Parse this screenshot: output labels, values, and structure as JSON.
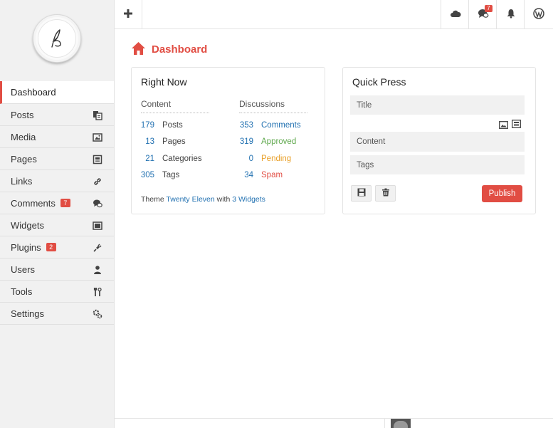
{
  "app": {
    "title": "Dashboard"
  },
  "colors": {
    "accent": "#e14d43",
    "link": "#2271b1",
    "approved": "#5fa84d",
    "pending": "#e9a12b",
    "spam": "#e14d43"
  },
  "topbar": {
    "add_icon": "plus-icon",
    "cloud_icon": "cloud-icon",
    "comments_icon": "comment-bubble-icon",
    "comments_badge": "7",
    "bell_icon": "bell-icon",
    "wp_icon": "wordpress-icon"
  },
  "sidebar": {
    "logo_icon": "pen-logo-icon",
    "items": [
      {
        "label": "Dashboard",
        "icon": "",
        "badge": ""
      },
      {
        "label": "Posts",
        "icon": "posts-icon",
        "badge": ""
      },
      {
        "label": "Media",
        "icon": "image-icon",
        "badge": ""
      },
      {
        "label": "Pages",
        "icon": "pages-icon",
        "badge": ""
      },
      {
        "label": "Links",
        "icon": "link-icon",
        "badge": ""
      },
      {
        "label": "Comments",
        "icon": "comments-icon",
        "badge": "7"
      },
      {
        "label": "Widgets",
        "icon": "widgets-icon",
        "badge": ""
      },
      {
        "label": "Plugins",
        "icon": "plugin-icon",
        "badge": "2"
      },
      {
        "label": "Users",
        "icon": "user-icon",
        "badge": ""
      },
      {
        "label": "Tools",
        "icon": "tools-icon",
        "badge": ""
      },
      {
        "label": "Settings",
        "icon": "settings-icon",
        "badge": ""
      }
    ]
  },
  "main": {
    "title": "Dashboard",
    "right_now": {
      "title": "Right Now",
      "content_header": "Content",
      "discussions_header": "Discussions",
      "content_rows": [
        {
          "count": "179",
          "label": "Posts"
        },
        {
          "count": "13",
          "label": "Pages"
        },
        {
          "count": "21",
          "label": "Categories"
        },
        {
          "count": "305",
          "label": "Tags"
        }
      ],
      "discussion_rows": [
        {
          "count": "353",
          "label": "Comments"
        },
        {
          "count": "319",
          "label": "Approved"
        },
        {
          "count": "0",
          "label": "Pending"
        },
        {
          "count": "34",
          "label": "Spam"
        }
      ],
      "theme_prefix": "Theme",
      "theme_name": "Twenty Eleven",
      "theme_with": "with",
      "widgets_link": "3 Widgets"
    },
    "quick_press": {
      "title": "Quick Press",
      "title_placeholder": "Title",
      "content_placeholder": "Content",
      "tags_placeholder": "Tags",
      "save_icon": "save-draft-icon",
      "trash_icon": "trash-icon",
      "publish_label": "Publish"
    }
  }
}
